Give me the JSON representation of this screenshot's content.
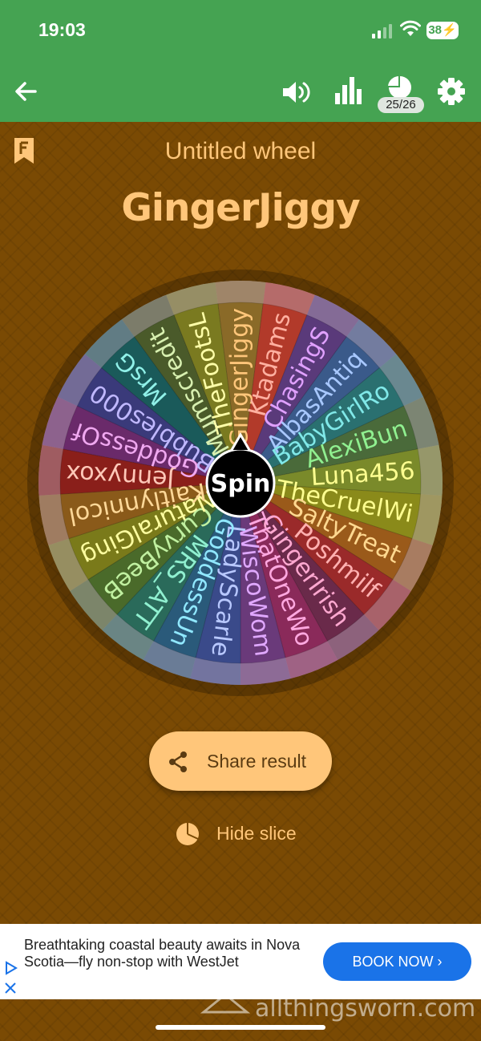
{
  "status": {
    "time": "19:03",
    "battery": "38"
  },
  "toolbar": {
    "counter": "25/26"
  },
  "wheel": {
    "title": "Untitled wheel",
    "result": "GingerJiggy",
    "spin_label": "Spin",
    "slices": [
      {
        "label": "GingerJiggy",
        "color": "#8a6a28"
      },
      {
        "label": "Ktadams",
        "color": "#b23a2a"
      },
      {
        "label": "ChasingS",
        "color": "#5a3a7a"
      },
      {
        "label": "AlbasAntiq",
        "color": "#3a5a8a"
      },
      {
        "label": "BabyGirlRo",
        "color": "#2a7070"
      },
      {
        "label": "AlexiBun",
        "color": "#4a6a3a"
      },
      {
        "label": "Luna456",
        "color": "#7a8a2a"
      },
      {
        "label": "TheCruelWi",
        "color": "#8a8a1a"
      },
      {
        "label": "SaltyTreat",
        "color": "#9a5a1a"
      },
      {
        "label": "Poshmilf",
        "color": "#9a2a2a"
      },
      {
        "label": "GingerIrish",
        "color": "#6a2a4a"
      },
      {
        "label": "ThatOneWo",
        "color": "#8a2a5a"
      },
      {
        "label": "WiscoWom",
        "color": "#6a3a7a"
      },
      {
        "label": "LadyScarle",
        "color": "#3a4a8a"
      },
      {
        "label": "GoddessUn",
        "color": "#2a5a7a"
      },
      {
        "label": "MRS_ATT",
        "color": "#2a6a5a"
      },
      {
        "label": "CurvyBeeB",
        "color": "#4a6a2a"
      },
      {
        "label": "NaturalGing",
        "color": "#7a7a1a"
      },
      {
        "label": "Kaitlynnicol",
        "color": "#8a5a1a"
      },
      {
        "label": "Jennyxox",
        "color": "#8a1f1a"
      },
      {
        "label": "GoddessOf",
        "color": "#6a2a6a"
      },
      {
        "label": "Bubbles000",
        "color": "#3a3a7a"
      },
      {
        "label": "MrsG",
        "color": "#1a5a5a"
      },
      {
        "label": "Mumscredit",
        "color": "#4a5a2a"
      },
      {
        "label": "TheFootsL",
        "color": "#7a7a20"
      }
    ],
    "label_colors": [
      "#ffc67a",
      "#ffb0a0",
      "#e0a0ff",
      "#a8c8ff",
      "#80e8e8",
      "#90f090",
      "#ffff90",
      "#ffff90",
      "#ffd890",
      "#ffb0b0",
      "#ffa8d0",
      "#ffa8e0",
      "#e0a8ff",
      "#b8c8ff",
      "#90e8ff",
      "#90f0d0",
      "#c0f0a0",
      "#ffffa0",
      "#ffd898",
      "#ffc8b8",
      "#f0a8f0",
      "#c0b8ff",
      "#90f0e8",
      "#d8f0b0",
      "#ffffa8"
    ]
  },
  "actions": {
    "share": "Share result",
    "hide": "Hide slice"
  },
  "ad": {
    "text": "Breathtaking coastal beauty awaits in Nova Scotia—fly non-stop with WestJet",
    "button": "BOOK NOW"
  },
  "watermark": {
    "text": "allthingsworn.com"
  }
}
